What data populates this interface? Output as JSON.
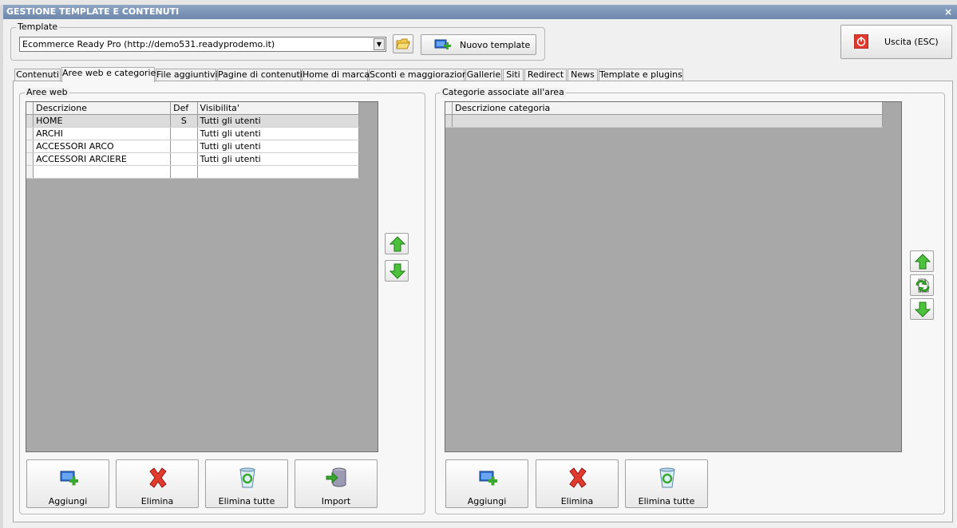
{
  "window": {
    "title": "GESTIONE TEMPLATE E CONTENUTI",
    "close_glyph": "×"
  },
  "template_group": {
    "legend": "Template",
    "combo_value": "Ecommerce Ready Pro (http://demo531.readyprodemo.it)",
    "new_template_label": "Nuovo template"
  },
  "exit_button": {
    "label": "Uscita (ESC)"
  },
  "tabs": [
    "Contenuti",
    "Aree web e categorie",
    "File aggiuntivi",
    "Pagine di contenuti",
    "Home di marca",
    "Sconti e maggiorazioni",
    "Gallerie",
    "Siti",
    "Redirect",
    "News",
    "Template e plugins"
  ],
  "active_tab": "Aree web e categorie",
  "aree_web": {
    "legend": "Aree web",
    "columns": [
      "Descrizione",
      "Def",
      "Visibilita'"
    ],
    "rows": [
      {
        "descrizione": "HOME",
        "def": "S",
        "visibilita": "Tutti gli utenti"
      },
      {
        "descrizione": "ARCHI",
        "def": "",
        "visibilita": "Tutti gli utenti"
      },
      {
        "descrizione": "ACCESSORI ARCO",
        "def": "",
        "visibilita": "Tutti gli utenti"
      },
      {
        "descrizione": "ACCESSORI ARCIERE",
        "def": "",
        "visibilita": "Tutti gli utenti"
      }
    ],
    "buttons": {
      "add": "Aggiungi",
      "delete": "Elimina",
      "delete_all": "Elimina tutte",
      "import": "Import"
    }
  },
  "categorie": {
    "legend": "Categorie associate all'area",
    "columns": [
      "Descrizione categoria"
    ],
    "buttons": {
      "add": "Aggiungi",
      "delete": "Elimina",
      "delete_all": "Elimina tutte"
    }
  },
  "colors": {
    "accent_green": "#3aa72e",
    "delete_red": "#e23b2e",
    "title_bar": "#7d95b7",
    "grid_bg": "#a8a8a8"
  }
}
